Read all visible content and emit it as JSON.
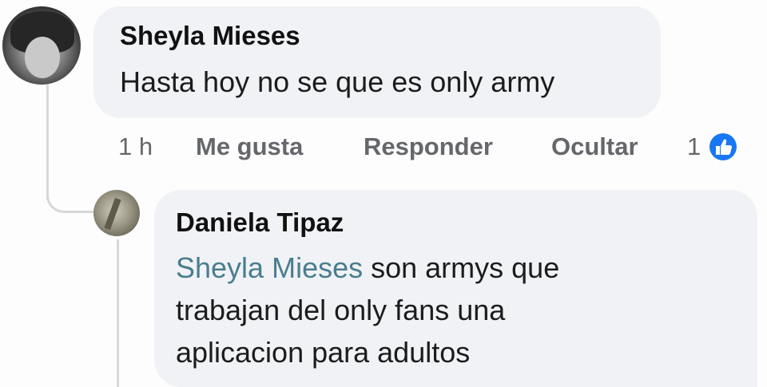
{
  "comment": {
    "author": "Sheyla Mieses",
    "text": "Hasta hoy no se que es only army",
    "actions": {
      "time": "1 h",
      "like": "Me gusta",
      "reply": "Responder",
      "hide": "Ocultar"
    },
    "reaction_count": "1",
    "reaction_icon": "like-icon",
    "reaction_color": "#1877f2"
  },
  "reply": {
    "author": "Daniela Tipaz",
    "mention": "Sheyla Mieses",
    "text_line1_rest": " son armys que",
    "text_line2": "trabajan del only fans una",
    "text_line3": "aplicacion para adultos"
  }
}
